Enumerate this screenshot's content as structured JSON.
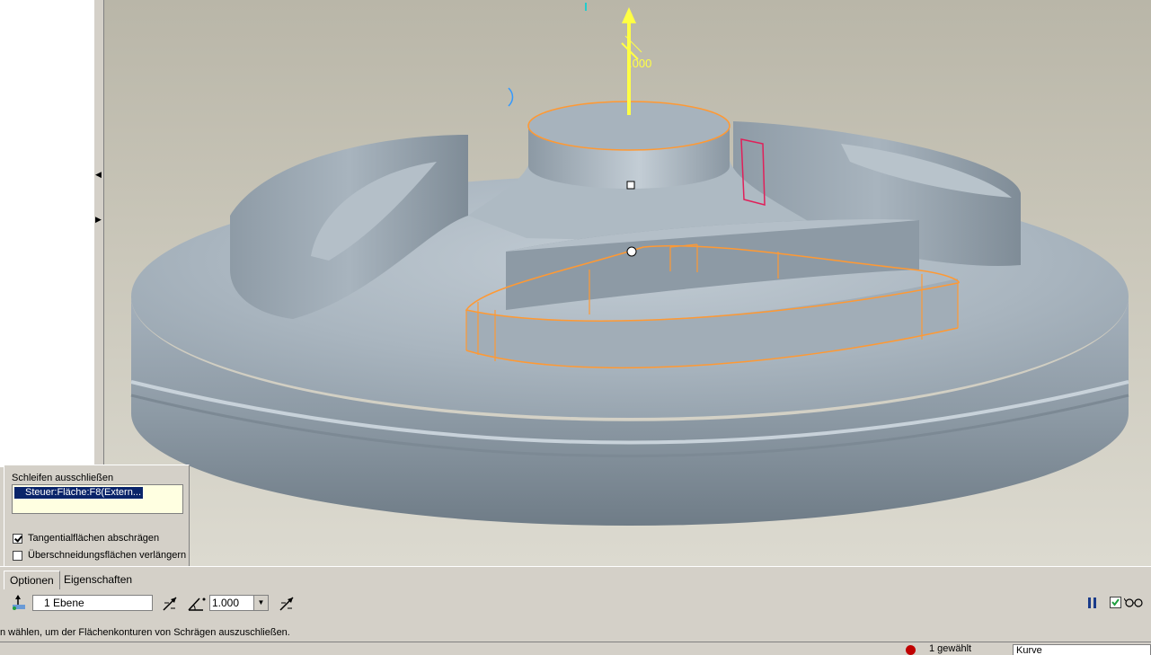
{
  "viewport": {
    "dimension_value": ".000",
    "colors": {
      "background_top": "#b9b6a8",
      "background_bottom": "#dcdad0",
      "model": "#a9b5bf",
      "highlight": "#ff9933",
      "drag_handle": "#ffff44",
      "selection": "#e0205a"
    }
  },
  "options_panel": {
    "title": "Schleifen ausschließen",
    "loop_list": [
      "Steuer:Fläche:F8(Extern..."
    ],
    "tangent_label": "Tangentialflächen abschrägen",
    "tangent_checked": true,
    "extend_label": "Überschneidungsflächen verlängern",
    "extend_checked": false
  },
  "tabs": [
    {
      "label": "Optionen",
      "active": true
    },
    {
      "label": "Eigenschaften",
      "active": false
    }
  ],
  "toolbar": {
    "reference_field": "1 Ebene",
    "angle_value": "1.000",
    "icons": [
      "draft-hinge-icon",
      "flip-pull-icon",
      "angle-icon",
      "flip-angle-icon",
      "pause-icon",
      "apply-check-icon",
      "preview-glasses-icon"
    ]
  },
  "status": {
    "message": "n wählen, um der Flächenkonturen von Schrägen auszuschließen.",
    "selection_count": "1 gewählt",
    "filter": "Kurve"
  }
}
